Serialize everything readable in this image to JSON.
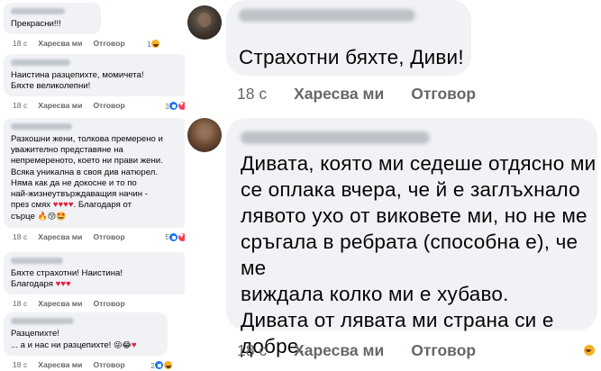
{
  "left_comments": [
    {
      "text": "Прекрасни!!!",
      "time": "18 с",
      "like": "Харесва ми",
      "reply": "Отговор",
      "reaction_count": "1"
    },
    {
      "text": "Наистина разцепихте, момичета!\nБяхте великолепни!",
      "time": "18 с",
      "like": "Харесва ми",
      "reply": "Отговор",
      "reaction_count": "3"
    },
    {
      "text": "Разкошни жени, толкова премерено и\nуважително представяне на\nнепремереното, което ни прави жени.\nВсяка уникална в своя див натюрел.\nНяма как да не докосне и то по\nнай-жизнеутвърждаващия начин -\nпрез смях ",
      "text_end": ". Благодаря от\nсърце",
      "time": "18 с",
      "like": "Харесва ми",
      "reply": "Отговор",
      "reaction_count": "5"
    },
    {
      "text": "Бяхте страхотни! Наистина!\nБлагодаря ",
      "time": "18 с",
      "like": "Харесва ми",
      "reply": "Отговор",
      "reaction_count": ""
    },
    {
      "text": "Разцепихте!\n... а и нас ни разцепихте!",
      "time": "18 с",
      "like": "Харесва ми",
      "reply": "Отговор",
      "reaction_count": "2"
    }
  ],
  "right_comments": [
    {
      "text": "Страхотни бяхте, Диви!",
      "time": "18 с",
      "like": "Харесва ми",
      "reply": "Отговор"
    },
    {
      "text": "Дивата, която ми седеше отдясно ми\nсе оплака вчера, че й е заглъхнало\nлявото ухо от виковете ми, но не ме\nсръгала в ребрата (способна е), че ме\nвиждала колко ми е хубаво.\nДивата от лявата ми страна си е\nдобре.",
      "time": "18 с",
      "like": "Харесва ми",
      "reply": "Отговор"
    }
  ],
  "hearts": "♥♥♥♥",
  "hearts_short": "♥♥♥",
  "colors": {
    "bubble": "#f0f2f5",
    "meta_text": "#65676b",
    "like_blue": "#1877f2",
    "love_red": "#f33e58"
  }
}
